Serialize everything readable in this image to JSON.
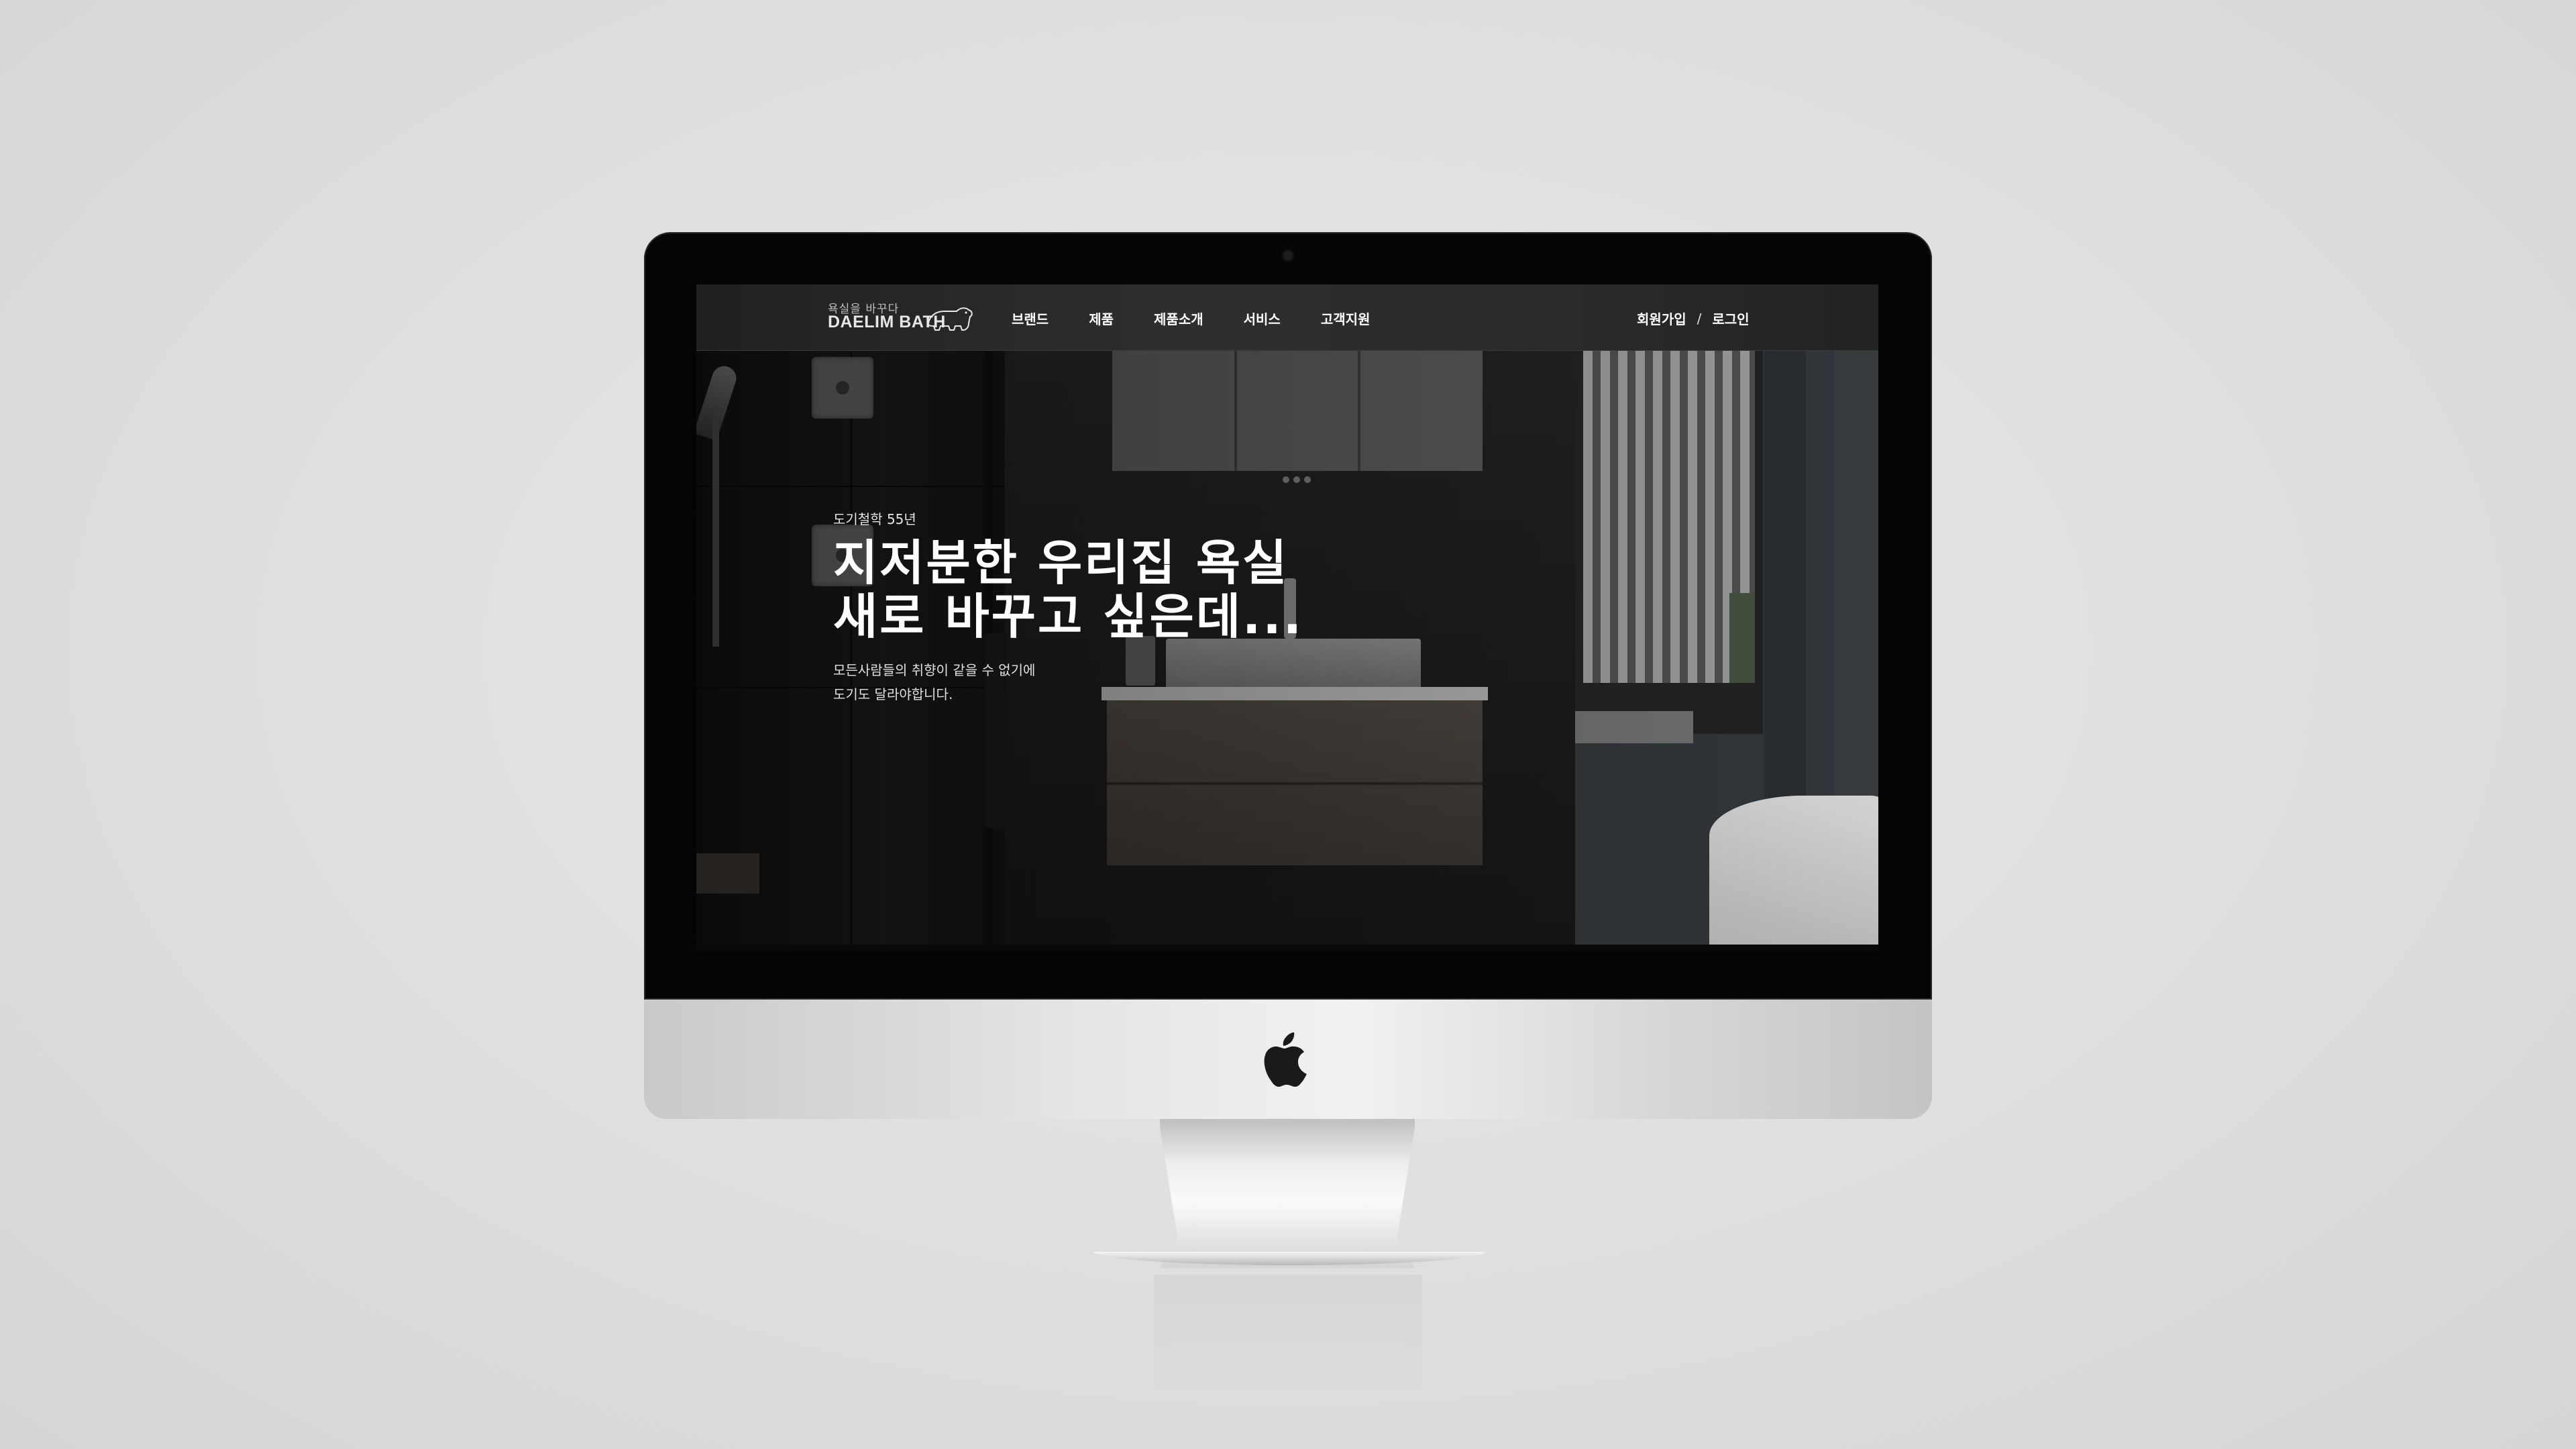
{
  "brand": {
    "tagline": "욕실을 바꾸다",
    "name": "DAELIM BATH"
  },
  "nav": {
    "items": [
      {
        "label": "브랜드"
      },
      {
        "label": "제품"
      },
      {
        "label": "제품소개"
      },
      {
        "label": "서비스"
      },
      {
        "label": "고객지원"
      }
    ]
  },
  "auth": {
    "signup_label": "회원가입",
    "separator": "/",
    "login_label": "로그인"
  },
  "hero": {
    "eyebrow": "도기철학 55년",
    "title_line1": "지저분한 우리집 욕실",
    "title_line2": "새로 바꾸고 싶은데...",
    "desc_line1": "모든사람들의 취향이 같을 수 없기에",
    "desc_line2": "도기도 달라야합니다."
  },
  "colors": {
    "header_bg": "#2b2b2b",
    "text_primary": "#ffffff",
    "page_bg": "#dedede",
    "bezel": "#050505"
  },
  "icons": {
    "logo_mark": "polar-bear-icon",
    "device_logo": "apple-icon"
  }
}
